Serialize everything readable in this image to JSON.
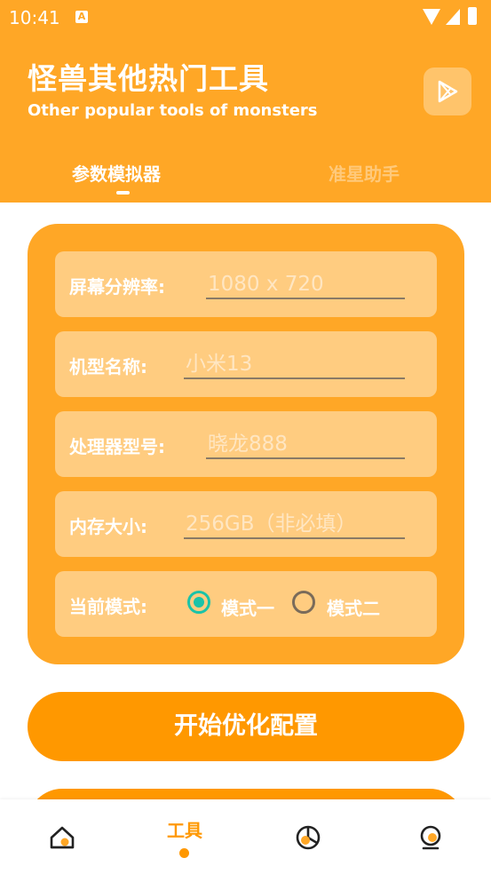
{
  "status_bar": {
    "time": "10:41",
    "notification_icon": "A"
  },
  "header": {
    "title": "怪兽其他热门工具",
    "subtitle": "Other popular tools of monsters",
    "tabs": [
      {
        "label": "参数模拟器",
        "active": true
      },
      {
        "label": "准星助手",
        "active": false
      }
    ]
  },
  "form": {
    "resolution": {
      "label": "屏幕分辨率:",
      "placeholder": "1080 x 720"
    },
    "model": {
      "label": "机型名称:",
      "placeholder": "小米13"
    },
    "processor": {
      "label": "处理器型号:",
      "placeholder": "晓龙888"
    },
    "memory": {
      "label": "内存大小:",
      "placeholder": "256GB（非必填）"
    },
    "mode": {
      "label": "当前模式:",
      "options": [
        {
          "label": "模式一",
          "selected": true
        },
        {
          "label": "模式二",
          "selected": false
        }
      ]
    }
  },
  "start_button": {
    "label": "开始优化配置"
  },
  "bottom_nav": {
    "items": [
      {
        "icon": "home-icon"
      },
      {
        "label": "工具",
        "active": true
      },
      {
        "icon": "pie-chart-icon"
      },
      {
        "icon": "webcam-icon"
      }
    ]
  },
  "colors": {
    "primary": "#FFA726",
    "accent": "#FF9800",
    "row_bg": "#FFCC80",
    "radio_selected": "#1BC3A8"
  }
}
